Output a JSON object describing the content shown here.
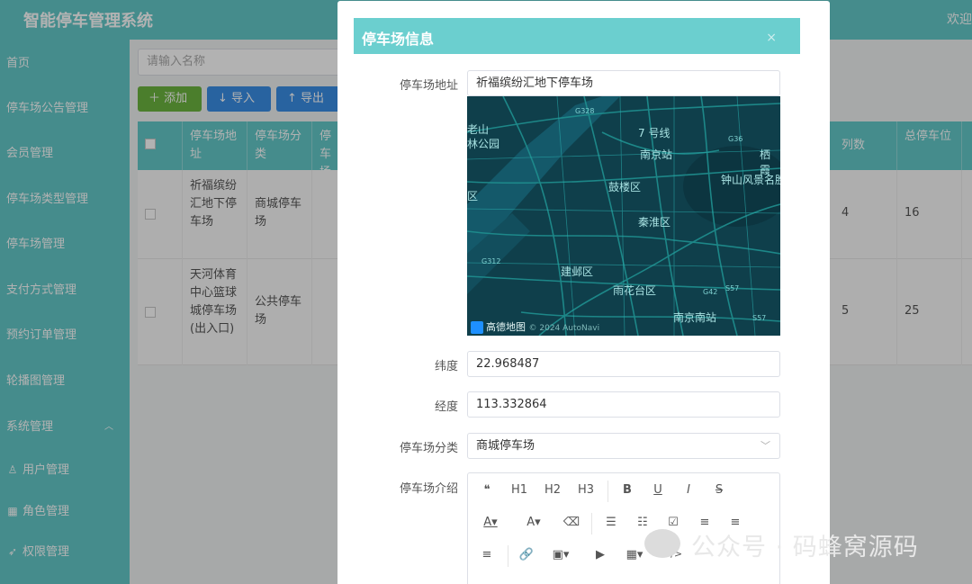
{
  "app": {
    "title": "智能停车管理系统",
    "welcome": "欢迎"
  },
  "sidebar": {
    "items": [
      {
        "label": "首页"
      },
      {
        "label": "停车场公告管理"
      },
      {
        "label": "会员管理"
      },
      {
        "label": "停车场类型管理"
      },
      {
        "label": "停车场管理"
      },
      {
        "label": "支付方式管理"
      },
      {
        "label": "预约订单管理"
      },
      {
        "label": "轮播图管理"
      },
      {
        "label": "系统管理"
      }
    ],
    "sub_items": [
      {
        "label": "用户管理",
        "icon": "user-icon"
      },
      {
        "label": "角色管理",
        "icon": "grid-icon"
      },
      {
        "label": "权限管理",
        "icon": "send-icon"
      }
    ]
  },
  "toolbar": {
    "search_placeholder": "请输入名称",
    "add_label": "＋ 添加",
    "import_label": "↓ 导入",
    "export_label": "↑ 导出"
  },
  "table": {
    "headers": [
      "停车场地址",
      "停车场分类",
      "停车场介",
      "列数",
      "总停车位"
    ],
    "rows": [
      {
        "address": "祈福缤纷汇地下停车场",
        "category": "商城停车场",
        "cols": "4",
        "total": "16"
      },
      {
        "address": "天河体育中心篮球城停车场(出入口)",
        "category": "公共停车场",
        "cols": "5",
        "total": "25"
      }
    ]
  },
  "modal": {
    "title": "停车场信息",
    "close": "×",
    "address_label": "停车场地址",
    "address_value": "祈福缤纷汇地下停车场",
    "lat_label": "纬度",
    "lat_value": "22.968487",
    "lng_label": "经度",
    "lng_value": "113.332864",
    "category_label": "停车场分类",
    "category_value": "商城停车场",
    "intro_label": "停车场介绍"
  },
  "map": {
    "labels": [
      "老山",
      "林公园",
      "7 号线",
      "南京站",
      "栖霞",
      "钟山风景名胜",
      "鼓楼区",
      "秦淮区",
      "区",
      "建邺区",
      "雨花台区",
      "南京南站"
    ],
    "road_codes": [
      "G328",
      "G36",
      "G312",
      "G42",
      "S57",
      "S57"
    ],
    "brand": "高德地图",
    "copyright": "© 2024 AutoNavi"
  },
  "editor": {
    "row1": [
      "❝",
      "H1",
      "H2",
      "H3",
      "B",
      "U",
      "I",
      "S"
    ],
    "row2": [
      "A▾",
      "A▾",
      "⌫",
      "☰",
      "☷",
      "☑",
      "≡",
      "≡"
    ],
    "row3": [
      "≡",
      "🔗",
      "▣▾",
      "▶",
      "▦▾",
      "</>"
    ]
  },
  "watermark": {
    "text": "公众号 · 码蜂窝源码"
  }
}
